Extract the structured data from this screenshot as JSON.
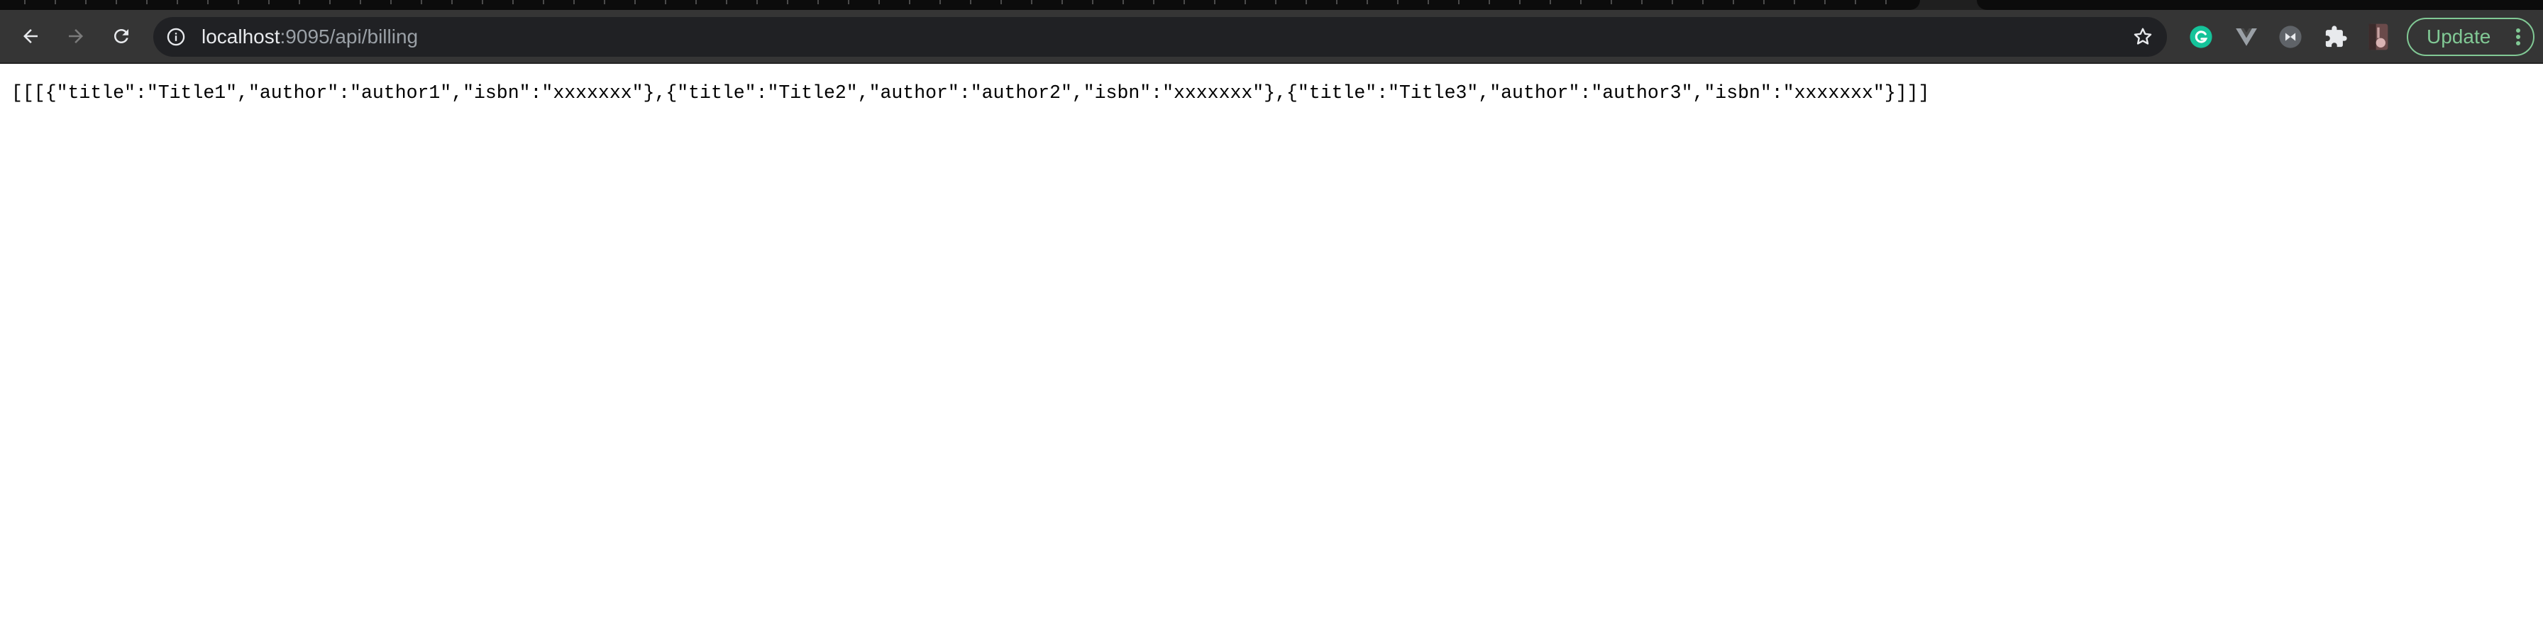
{
  "browser": {
    "address_bar": {
      "host": "localhost",
      "path": ":9095/api/billing"
    },
    "update_button_label": "Update",
    "extensions": [
      "grammarly-icon",
      "vue-devtools-icon",
      "extension-icon",
      "puzzle-icon",
      "profile-icon"
    ]
  },
  "page": {
    "body_text": "[[[{\"title\":\"Title1\",\"author\":\"author1\",\"isbn\":\"xxxxxxx\"},{\"title\":\"Title2\",\"author\":\"author2\",\"isbn\":\"xxxxxxx\"},{\"title\":\"Title3\",\"author\":\"author3\",\"isbn\":\"xxxxxxx\"}]]]"
  },
  "colors": {
    "toolbar": "#353535",
    "omnibox": "#202124",
    "update_accent": "#81c995",
    "grammarly": "#15c39a"
  }
}
